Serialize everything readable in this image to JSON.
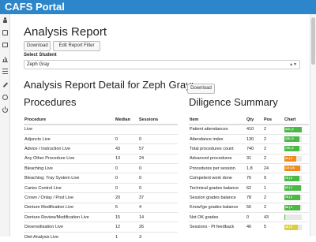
{
  "app": {
    "title": "CAFS Portal"
  },
  "colors": {
    "topbar": "#2c86c9",
    "green": "#4cb848",
    "orange": "#ef8a1c",
    "yellow": "#d9cf45"
  },
  "sidebar": {
    "icons": [
      "user-icon",
      "inbox-icon",
      "card-icon",
      "bar-chart-icon",
      "list-icon",
      "wrench-icon",
      "gear-icon",
      "power-icon"
    ]
  },
  "report": {
    "title": "Analysis Report",
    "download_label": "Download",
    "edit_filter_label": "Edit Report Filter",
    "select_student_label": "Select Student",
    "selected_student": "Zeph Gray",
    "detail_title": "Analysis Report Detail for Zeph Gray:",
    "detail_download_label": "Download"
  },
  "procedures": {
    "title": "Procedures",
    "headers": [
      "Procedure",
      "Median",
      "Sessions"
    ],
    "rows": [
      [
        "Live",
        "",
        ""
      ],
      [
        "Adjuncts Live",
        "0",
        "0"
      ],
      [
        "Advice / Instruction Live",
        "43",
        "57"
      ],
      [
        "Any Other Procedure Live",
        "13",
        "24"
      ],
      [
        "Bleaching Live",
        "0",
        "0"
      ],
      [
        "Bleaching: Tray System Live",
        "0",
        "0"
      ],
      [
        "Caries Control Live",
        "0",
        "0"
      ],
      [
        "Crown / Onlay / Post Live",
        "20",
        "37"
      ],
      [
        "Denture Modification Live",
        "6",
        "4"
      ],
      [
        "Denture Review/Modification Live",
        "15",
        "14"
      ],
      [
        "Desensitisation Live",
        "12",
        "26"
      ],
      [
        "Diet Analysis Live",
        "1",
        "3"
      ]
    ]
  },
  "diligence": {
    "title": "Diligence Summary",
    "headers": [
      "Item",
      "Qty",
      "Pos",
      "Chart"
    ],
    "rows": [
      {
        "item": "Patient attendances",
        "qty": "410",
        "pos": "2",
        "chart_label": "410 | 2",
        "fill": 1.0,
        "color": "green"
      },
      {
        "item": "Attendance index",
        "qty": "130",
        "pos": "2",
        "chart_label": "130 | 2",
        "fill": 0.85,
        "color": "green"
      },
      {
        "item": "Total procedures count",
        "qty": "740",
        "pos": "2",
        "chart_label": "740 | 2",
        "fill": 0.85,
        "color": "green"
      },
      {
        "item": "Advanced procedures",
        "qty": "31",
        "pos": "2",
        "chart_label": "31 | 2",
        "fill": 0.7,
        "color": "orange"
      },
      {
        "item": "Procedures per session",
        "qty": "1.8",
        "pos": "24",
        "chart_label": "1.8 | 24",
        "fill": 0.9,
        "color": "orange"
      },
      {
        "item": "Competent work done",
        "qty": "76",
        "pos": "9",
        "chart_label": "76 | 9",
        "fill": 0.85,
        "color": "green"
      },
      {
        "item": "Technical grades balance",
        "qty": "62",
        "pos": "1",
        "chart_label": "62 | 1",
        "fill": 0.95,
        "color": "green"
      },
      {
        "item": "Session grades balance",
        "qty": "78",
        "pos": "2",
        "chart_label": "78 | 2",
        "fill": 0.9,
        "color": "green"
      },
      {
        "item": "Knowl'ge grades balance",
        "qty": "56",
        "pos": "2",
        "chart_label": "56 | 2",
        "fill": 0.9,
        "color": "green"
      },
      {
        "item": "Not OK grades",
        "qty": "0",
        "pos": "43",
        "chart_label": "",
        "fill": 0.0,
        "color": "green"
      },
      {
        "item": "Sessions - Pt feedback",
        "qty": "46",
        "pos": "5",
        "chart_label": "46 | 5",
        "fill": 0.75,
        "color": "yellow"
      }
    ]
  }
}
